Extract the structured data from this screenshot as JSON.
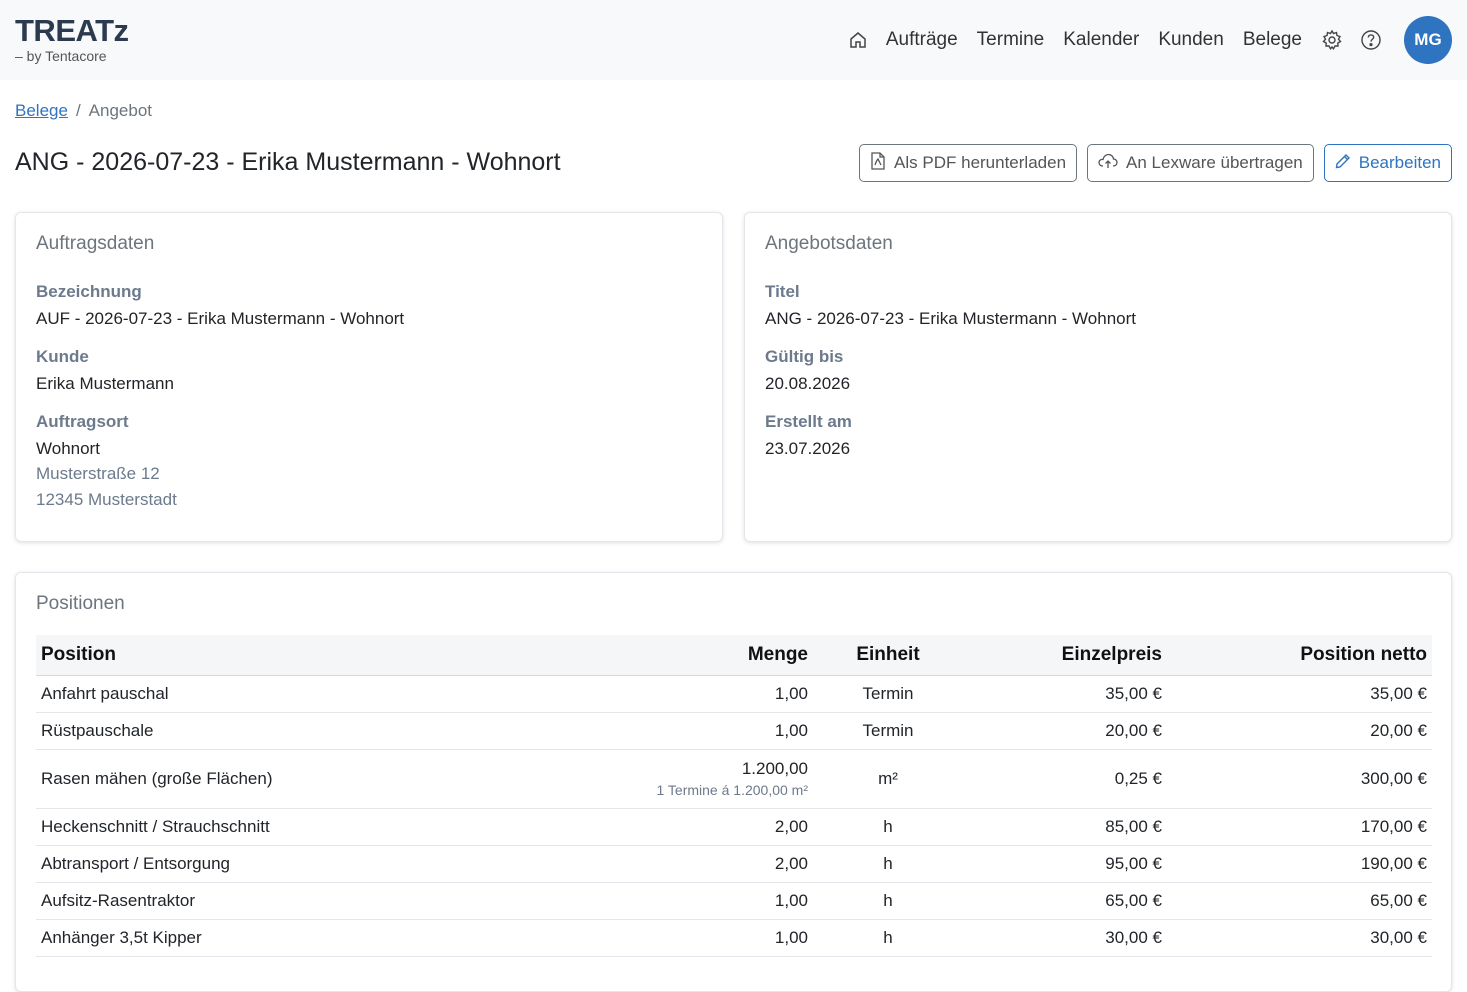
{
  "brand": {
    "name": "TREATz",
    "tagline": "– by Tentacore"
  },
  "nav": {
    "links": [
      "Aufträge",
      "Termine",
      "Kalender",
      "Kunden",
      "Belege"
    ],
    "avatar": "MG"
  },
  "breadcrumb": {
    "parent": "Belege",
    "separator": "/",
    "current": "Angebot"
  },
  "page": {
    "title": "ANG - 2026-07-23 - Erika Mustermann - Wohnort"
  },
  "actions": {
    "pdf": "Als PDF herunterladen",
    "lexware": "An Lexware übertragen",
    "edit": "Bearbeiten"
  },
  "auftragsdaten": {
    "title": "Auftragsdaten",
    "bezeichnung_label": "Bezeichnung",
    "bezeichnung": "AUF - 2026-07-23 - Erika Mustermann - Wohnort",
    "kunde_label": "Kunde",
    "kunde": "Erika Mustermann",
    "ort_label": "Auftragsort",
    "ort_name": "Wohnort",
    "ort_strasse": "Musterstraße 12",
    "ort_stadt": "12345 Musterstadt"
  },
  "angebotsdaten": {
    "title": "Angebotsdaten",
    "titel_label": "Titel",
    "titel": "ANG - 2026-07-23 - Erika Mustermann - Wohnort",
    "gueltig_label": "Gültig bis",
    "gueltig": "20.08.2026",
    "erstellt_label": "Erstellt am",
    "erstellt": "23.07.2026"
  },
  "positionen": {
    "title": "Positionen",
    "headers": {
      "position": "Position",
      "menge": "Menge",
      "einheit": "Einheit",
      "einzelpreis": "Einzelpreis",
      "netto": "Position netto"
    },
    "rows": [
      {
        "position": "Anfahrt pauschal",
        "menge": "1,00",
        "einheit": "Termin",
        "einzelpreis": "35,00 €",
        "netto": "35,00 €"
      },
      {
        "position": "Rüstpauschale",
        "menge": "1,00",
        "einheit": "Termin",
        "einzelpreis": "20,00 €",
        "netto": "20,00 €"
      },
      {
        "position": "Rasen mähen (große Flächen)",
        "menge": "1.200,00",
        "menge_sub": "1 Termine á 1.200,00 m²",
        "einheit": "m²",
        "einzelpreis": "0,25 €",
        "netto": "300,00 €"
      },
      {
        "position": "Heckenschnitt / Strauchschnitt",
        "menge": "2,00",
        "einheit": "h",
        "einzelpreis": "85,00 €",
        "netto": "170,00 €"
      },
      {
        "position": "Abtransport / Entsorgung",
        "menge": "2,00",
        "einheit": "h",
        "einzelpreis": "95,00 €",
        "netto": "190,00 €"
      },
      {
        "position": "Aufsitz-Rasentraktor",
        "menge": "1,00",
        "einheit": "h",
        "einzelpreis": "65,00 €",
        "netto": "65,00 €"
      },
      {
        "position": "Anhänger 3,5t Kipper",
        "menge": "1,00",
        "einheit": "h",
        "einzelpreis": "30,00 €",
        "netto": "30,00 €"
      }
    ]
  },
  "icons": [
    "home-icon",
    "gear-icon",
    "help-icon",
    "pdf-icon",
    "cloud-upload-icon",
    "pencil-icon"
  ],
  "colors": {
    "accent": "#2e74c0",
    "topbar": "#f8f9fa",
    "label": "#6c7a8c"
  }
}
